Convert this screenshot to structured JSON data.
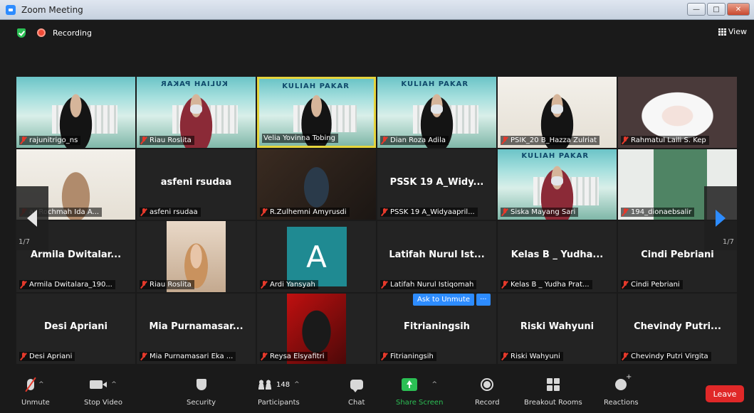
{
  "window": {
    "title": "Zoom Meeting",
    "controls": {
      "minimize": "—",
      "maximize": "□",
      "close": "✕"
    }
  },
  "topbar": {
    "recording_label": "Recording",
    "view_label": "View"
  },
  "tiles": [
    {
      "name": "rajunitrigo_ns"
    },
    {
      "name": "Riau Roslita",
      "banner": "KULIAH PAKAR"
    },
    {
      "name": "Velia Yovinna Tobing",
      "banner": "KULIAH PAKAR"
    },
    {
      "name": "Dian Roza Adila",
      "banner": "KULIAH PAKAR"
    },
    {
      "name": "PSIK_20 B_Hazza Zulriat"
    },
    {
      "name": "Rahmatul Laili S. Kep"
    },
    {
      "name": "ar Rochmah Ida A..."
    },
    {
      "name": "asfeni rsudaa",
      "display": "asfeni rsudaa"
    },
    {
      "name": "R.Zulhemni Amyrusdi"
    },
    {
      "name": "PSSK 19 A_Widyaapril...",
      "display": "PSSK 19 A_Widy..."
    },
    {
      "name": "Siska Mayang Sari",
      "banner": "KULIAH PAKAR"
    },
    {
      "name": "194_dionaebsalir"
    },
    {
      "name": "Armila Dwitalara_190...",
      "display": "Armila Dwitalar..."
    },
    {
      "name": "Riau Roslita"
    },
    {
      "name": "Ardi Yansyah",
      "avatar_letter": "A"
    },
    {
      "name": "Latifah Nurul Istiqomah",
      "display": "Latifah Nurul Ist..."
    },
    {
      "name": "Kelas B _ Yudha Prat...",
      "display": "Kelas B _ Yudha..."
    },
    {
      "name": "Cindi Pebriani",
      "display": "Cindi Pebriani"
    },
    {
      "name": "Desi Apriani",
      "display": "Desi Apriani"
    },
    {
      "name": "Mia Purnamasari Eka ...",
      "display": "Mia Purnamasar..."
    },
    {
      "name": "Reysa Elsyafitri"
    },
    {
      "name": "Fitrianingsih",
      "display": "Fitrianingsih"
    },
    {
      "name": "Riski Wahyuni",
      "display": "Riski Wahyuni"
    },
    {
      "name": "Chevindy Putri Virgita",
      "display": "Chevindy Putri..."
    }
  ],
  "ask_to_unmute": {
    "label": "Ask to Unmute",
    "more": "···"
  },
  "pager": {
    "left_page": "1/7",
    "right_page": "1/7"
  },
  "toolbar": {
    "unmute": "Unmute",
    "stop_video": "Stop Video",
    "security": "Security",
    "participants": "Participants",
    "participants_count": "148",
    "chat": "Chat",
    "share_screen": "Share Screen",
    "record": "Record",
    "breakout_rooms": "Breakout Rooms",
    "reactions": "Reactions",
    "leave": "Leave",
    "caret": "^"
  },
  "colors": {
    "accent": "#2d8cff",
    "share_green": "#2bbf54",
    "leave_red": "#e02828",
    "active_speaker": "#e5d43c",
    "muted_red": "#e5392b"
  }
}
